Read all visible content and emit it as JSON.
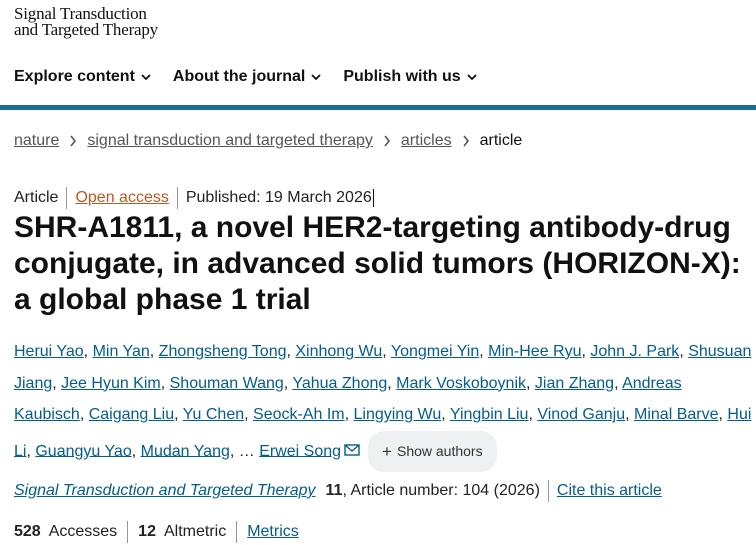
{
  "journal": {
    "logo_line1": "Signal Transduction",
    "logo_line2": "and Targeted Therapy"
  },
  "nav": {
    "items": [
      "Explore content",
      "About the journal",
      "Publish with us"
    ]
  },
  "breadcrumb": {
    "items": [
      "nature",
      "signal transduction and targeted therapy",
      "articles"
    ],
    "current": "article"
  },
  "meta": {
    "type": "Article",
    "access": "Open access",
    "published": "Published: 19 March 2026"
  },
  "title": "SHR-A1811, a novel HER2-targeting antibody-drug conjugate, in advanced solid tumors (HORIZON-X): a global phase 1 trial",
  "authors": {
    "list": [
      "Herui Yao",
      "Min Yan",
      "Zhongsheng Tong",
      "Xinhong Wu",
      "Yongmei Yin",
      "Min-Hee Ryu",
      "John J. Park",
      "Shusuan Jiang",
      "Jee Hyun Kim",
      "Shouman Wang",
      "Yahua Zhong",
      "Mark Voskoboynik",
      "Jian Zhang",
      "Andreas Kaubisch",
      "Caigang Liu",
      "Yu Chen",
      "Seock-Ah Im",
      "Lingying Wu",
      "Yingbin Liu",
      "Vinod Ganju",
      "Minal Barve",
      "Hui Li",
      "Guangyu Yao",
      "Mudan Yang"
    ],
    "ellipsis": "…",
    "last": "Erwei Song",
    "show_authors": "Show authors"
  },
  "citation": {
    "journal": "Signal Transduction and Targeted Therapy",
    "volume": "11",
    "article_number": ", Article number: 104 (2026)",
    "cite": "Cite this article"
  },
  "metrics": {
    "accesses_count": "528",
    "accesses_label": "Accesses",
    "altmetric_count": "12",
    "altmetric_label": "Altmetric",
    "metrics_link": "Metrics"
  },
  "colors": {
    "link": "#025e8d",
    "accent_rule": "#1b6c94",
    "open_access": "#c05920"
  }
}
